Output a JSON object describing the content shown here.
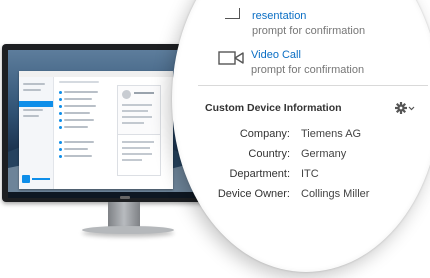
{
  "panel": {
    "partial_item": {
      "title": "resentation",
      "subtitle": "prompt for confirmation"
    },
    "video_call": {
      "title": "Video Call",
      "subtitle": "prompt for confirmation",
      "icon": "video-camera-icon"
    }
  },
  "custom_info": {
    "section_title": "Custom Device Information",
    "settings_icon": "gear-icon",
    "fields": [
      {
        "label": "Company:",
        "value": "Tiemens AG"
      },
      {
        "label": "Country:",
        "value": "Germany"
      },
      {
        "label": "Department:",
        "value": "ITC"
      },
      {
        "label": "Device Owner:",
        "value": "Collings Miller"
      }
    ]
  },
  "colors": {
    "accent": "#0a6ec4",
    "brand": "#0e8ee9",
    "text": "#333333",
    "muted": "#777777"
  }
}
